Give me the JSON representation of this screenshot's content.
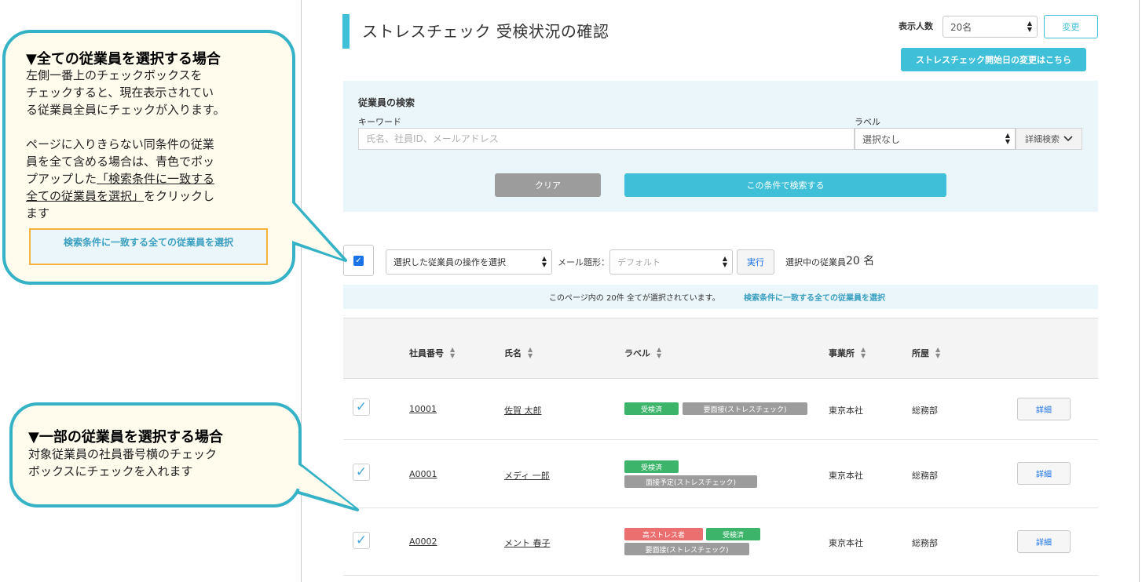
{
  "header": {
    "title": "ストレスチェック 受検状況の確認",
    "count_label": "表示人数",
    "count_value": "20名",
    "change_button": "変更",
    "start_date_button": "ストレスチェック開始日の変更はこちら"
  },
  "search": {
    "heading": "従業員の検索",
    "keyword_label": "キーワード",
    "keyword_placeholder": "氏名、社員ID、メールアドレス",
    "label_label": "ラベル",
    "label_value": "選択なし",
    "detail_search": "詳細検索",
    "clear_button": "クリア",
    "search_button": "この条件で検索する"
  },
  "actions": {
    "operation_select": "選択した従業員の操作を選択",
    "mail_label": "メール題形：",
    "mail_select": "デフォルト",
    "execute_button": "実行",
    "selected_label": "選択中の従業員",
    "selected_count": "20 名"
  },
  "notice": {
    "text": "このページ内の 20件 全てが選択されています。",
    "link": "検索条件に一致する全ての従業員を選択"
  },
  "table": {
    "headers": [
      "社員番号",
      "氏名",
      "ラベル",
      "事業所",
      "所屋"
    ],
    "rows": [
      {
        "id": "10001",
        "name": "佐賀 太郎",
        "tags": [
          {
            "text": "受検済",
            "color": "green"
          },
          {
            "text": "要面接(ストレスチェック)",
            "color": "gray"
          }
        ],
        "office": "東京本社",
        "dept": "総務部",
        "detail": "詳細"
      },
      {
        "id": "A0001",
        "name": "メディ 一郎",
        "tags": [
          {
            "text": "受検済",
            "color": "green"
          },
          {
            "text": "面接予定(ストレスチェック)",
            "color": "gray"
          }
        ],
        "office": "東京本社",
        "dept": "総務部",
        "detail": "詳細"
      },
      {
        "id": "A0002",
        "name": "メント 春子",
        "tags": [
          {
            "text": "高ストレス者",
            "color": "red"
          },
          {
            "text": "受検済",
            "color": "green"
          },
          {
            "text": "要面接(ストレスチェック)",
            "color": "gray"
          }
        ],
        "office": "東京本社",
        "dept": "総務部",
        "detail": "詳細"
      }
    ]
  },
  "callouts": {
    "all": {
      "title": "▼全ての従業員を選択する場合",
      "line1": "左側一番上のチェックボックスを",
      "line2": "チェックすると、現在表示されてい",
      "line3": "る従業員全員にチェックが入ります。",
      "line4": "ページに入りきらない同条件の従業",
      "line5": "員を全て含める場合は、青色でポッ",
      "line6a": "プアップした",
      "line6b": "「検索条件に一致する",
      "line7a": "全ての従業員を選択」",
      "line7b": "をクリックし",
      "line8": "ます",
      "button": "検索条件に一致する全ての従業員を選択"
    },
    "partial": {
      "title": "▼一部の従業員を選択する場合",
      "line1": "対象従業員の社員番号横のチェック",
      "line2": "ボックスにチェックを入れます"
    }
  },
  "colors": {
    "accent": "#3fbfd8",
    "callout_border": "#35b2c6",
    "callout_bg": "#fffbed",
    "highlight_border": "#f3b33c"
  }
}
